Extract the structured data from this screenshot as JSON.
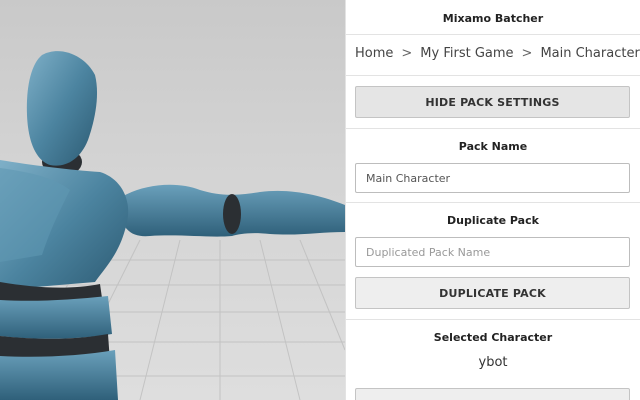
{
  "app": {
    "title": "Mixamo Batcher"
  },
  "breadcrumb": {
    "items": [
      "Home",
      "My First Game",
      "Main Character"
    ],
    "separator": ">"
  },
  "pack_settings": {
    "toggle_label": "HIDE PACK SETTINGS"
  },
  "pack_name": {
    "heading": "Pack Name",
    "value": "Main Character",
    "placeholder": "Main Character"
  },
  "duplicate_pack": {
    "heading": "Duplicate Pack",
    "placeholder": "Duplicated Pack Name",
    "button_label": "DUPLICATE PACK"
  },
  "selected_character": {
    "heading": "Selected Character",
    "value": "ybot"
  },
  "colors": {
    "character_body": "#3f7590",
    "character_joint": "#2b2f33",
    "panel_border": "#e3e3e3",
    "button_bg": "#e5e5e5"
  }
}
